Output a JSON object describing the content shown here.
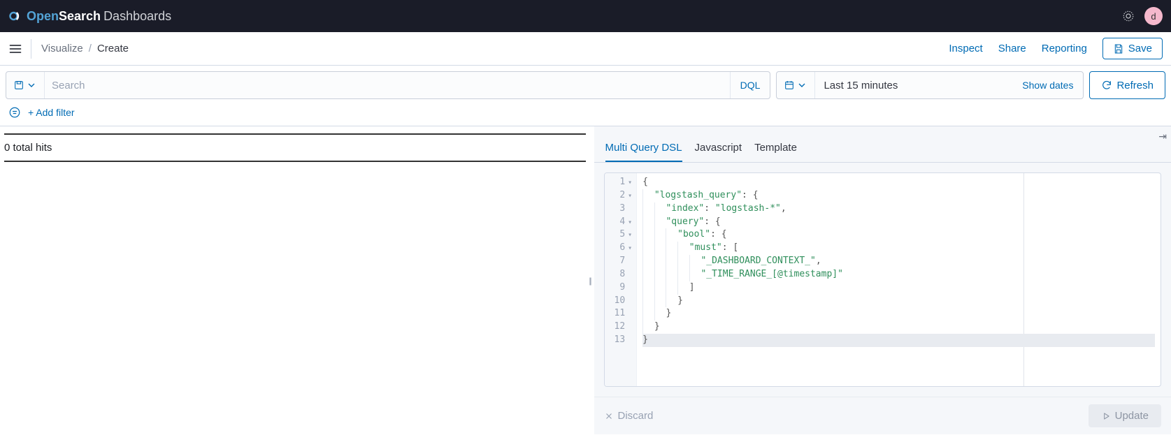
{
  "brand": {
    "open": "Open",
    "search": "Search",
    "dash": "Dashboards",
    "avatar_initial": "d"
  },
  "breadcrumb": {
    "parent": "Visualize",
    "current": "Create"
  },
  "sub_actions": {
    "inspect": "Inspect",
    "share": "Share",
    "reporting": "Reporting",
    "save": "Save"
  },
  "search": {
    "placeholder": "Search",
    "dql_label": "DQL"
  },
  "time": {
    "range": "Last 15 minutes",
    "show_dates": "Show dates",
    "refresh": "Refresh"
  },
  "filter": {
    "add_label": "+ Add filter"
  },
  "results": {
    "hits": "0 total hits"
  },
  "tabs": {
    "t1": "Multi Query DSL",
    "t2": "Javascript",
    "t3": "Template"
  },
  "editor": {
    "line_numbers": [
      "1",
      "2",
      "3",
      "4",
      "5",
      "6",
      "7",
      "8",
      "9",
      "10",
      "11",
      "12",
      "13"
    ],
    "fold_lines": [
      1,
      2,
      4,
      5,
      6
    ],
    "active_line": 13,
    "code": [
      {
        "indent": 0,
        "tokens": [
          {
            "t": "p",
            "v": "{"
          }
        ]
      },
      {
        "indent": 1,
        "tokens": [
          {
            "t": "k",
            "v": "\"logstash_query\""
          },
          {
            "t": "p",
            "v": ": {"
          }
        ]
      },
      {
        "indent": 2,
        "tokens": [
          {
            "t": "k",
            "v": "\"index\""
          },
          {
            "t": "p",
            "v": ": "
          },
          {
            "t": "s",
            "v": "\"logstash-*\""
          },
          {
            "t": "p",
            "v": ","
          }
        ]
      },
      {
        "indent": 2,
        "tokens": [
          {
            "t": "k",
            "v": "\"query\""
          },
          {
            "t": "p",
            "v": ": {"
          }
        ]
      },
      {
        "indent": 3,
        "tokens": [
          {
            "t": "k",
            "v": "\"bool\""
          },
          {
            "t": "p",
            "v": ": {"
          }
        ]
      },
      {
        "indent": 4,
        "tokens": [
          {
            "t": "k",
            "v": "\"must\""
          },
          {
            "t": "p",
            "v": ": ["
          }
        ]
      },
      {
        "indent": 5,
        "tokens": [
          {
            "t": "s",
            "v": "\"_DASHBOARD_CONTEXT_\""
          },
          {
            "t": "p",
            "v": ","
          }
        ]
      },
      {
        "indent": 5,
        "tokens": [
          {
            "t": "s",
            "v": "\"_TIME_RANGE_[@timestamp]\""
          }
        ]
      },
      {
        "indent": 4,
        "tokens": [
          {
            "t": "p",
            "v": "]"
          }
        ]
      },
      {
        "indent": 3,
        "tokens": [
          {
            "t": "p",
            "v": "}"
          }
        ]
      },
      {
        "indent": 2,
        "tokens": [
          {
            "t": "p",
            "v": "}"
          }
        ]
      },
      {
        "indent": 1,
        "tokens": [
          {
            "t": "p",
            "v": "}"
          }
        ]
      },
      {
        "indent": 0,
        "tokens": [
          {
            "t": "p",
            "v": "}"
          }
        ]
      }
    ]
  },
  "actions": {
    "discard": "Discard",
    "update": "Update"
  }
}
